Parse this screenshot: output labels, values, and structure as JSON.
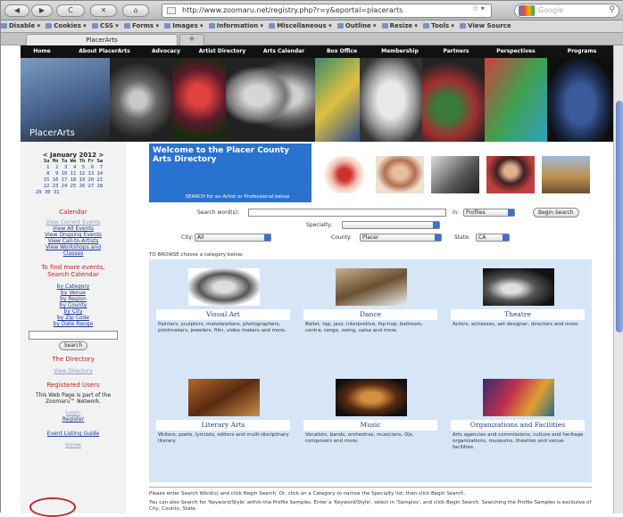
{
  "browser": {
    "nav_buttons": [
      "◀",
      "▶",
      "C",
      "✕",
      "⌂"
    ],
    "url": "http://www.zoomaru.net/registry.php?r=y&eportal=placerarts",
    "rss_icon": "☆ ▾",
    "search_placeholder": "Google",
    "bookmarks": [
      "Disable",
      "Cookies",
      "CSS",
      "Forms",
      "Images",
      "Information",
      "Miscellaneous",
      "Outline",
      "Resize",
      "Tools",
      "View Source"
    ],
    "tab_title": "PlacerArts",
    "new_tab": "+"
  },
  "site": {
    "nav": [
      "Home",
      "About PlacerArts",
      "Advocacy",
      "Artist Directory",
      "Arts Calendar",
      "Box Office",
      "Membership",
      "Partners",
      "Perspectives",
      "Programs"
    ],
    "brand": "PlacerArts",
    "colors": {
      "nav_bg": "#111111",
      "welcome_bg": "#2a72cf",
      "panel_bg": "#d6e6f7",
      "alert_red": "#c02020"
    }
  },
  "sidebar": {
    "calendar_title": "< January 2012 >",
    "cal_header": "Su Mo Tu We Th Fr Sa",
    "cal_rows": [
      " 1  2  3  4  5  6  7",
      " 8  9 10 11 12 13 14",
      "15 16 17 18 19 20 21",
      "22 23 24 25 26 27 28",
      "29 30 31"
    ],
    "calendar_heading": "Calendar",
    "calendar_links": [
      "View Current Events",
      "View All Events",
      "View Ongoing Events",
      "View Call-to-Artists",
      "View Workshops and Classes"
    ],
    "find_heading": "To find more events, Search Calendar",
    "search_links": [
      "by Category",
      "by Venue",
      "by Region",
      "by County",
      "by City",
      "by Zip Code",
      "by Date Range"
    ],
    "search_button": "Search",
    "directory_heading": "The Directory",
    "directory_link": "View Directory",
    "registered_heading": "Registered Users",
    "network_text": "This Web Page is part of the Zoomaru™ Network.",
    "login": "Login",
    "register": "Register",
    "event_guide": "Event Listing Guide",
    "home": "Home"
  },
  "main": {
    "welcome_title": "Welcome to the Placer County Arts Directory",
    "welcome_sub": "SEARCH for an Artist or Professional below",
    "search_label": "Search word(s):",
    "in_label": "in:",
    "in_value": "Profiles",
    "begin_button": "Begin Search",
    "specialty_label": "Specialty:",
    "city_label": "City:",
    "city_value": "All",
    "county_label": "County:",
    "county_value": "Placer",
    "state_label": "State:",
    "state_value": "CA",
    "browse_text": "TO BROWSE choose a category below.",
    "categories": [
      {
        "title": "Visual Art",
        "desc": "Painters, sculptors, metalworkers, photographers, printmakers, jewelers, film, video makers and more."
      },
      {
        "title": "Dance",
        "desc": "Ballet, tap, jazz, interpretive, hip-hop, ballroom, contra, tango, swing, salsa and more."
      },
      {
        "title": "Theatre",
        "desc": "Actors, actresses, set designer, directors and more."
      },
      {
        "title": "Literary Arts",
        "desc": "Writers, poets, lyricists, editors and multi-disciplinary literary."
      },
      {
        "title": "Music",
        "desc": "Vocalists, bands, orchestras, musicians, DJs, composers and more."
      },
      {
        "title": "Organizations and Facilities",
        "desc": "Arts agencies and commissions, culture and heritage organizations, museums, theatres and venue facilities."
      }
    ],
    "instr1": "Please enter Search Word(s) and click Begin Search. Or, click on a Category to narrow the Specialty list, then click Begin Search.",
    "instr2": "You can also Search for 'Keyword/Style' within the Profile Samples. Enter a 'Keyword/Style', select in 'Samples', and click Begin Search. Searching the Profile Samples is exclusive of City, County, State."
  }
}
